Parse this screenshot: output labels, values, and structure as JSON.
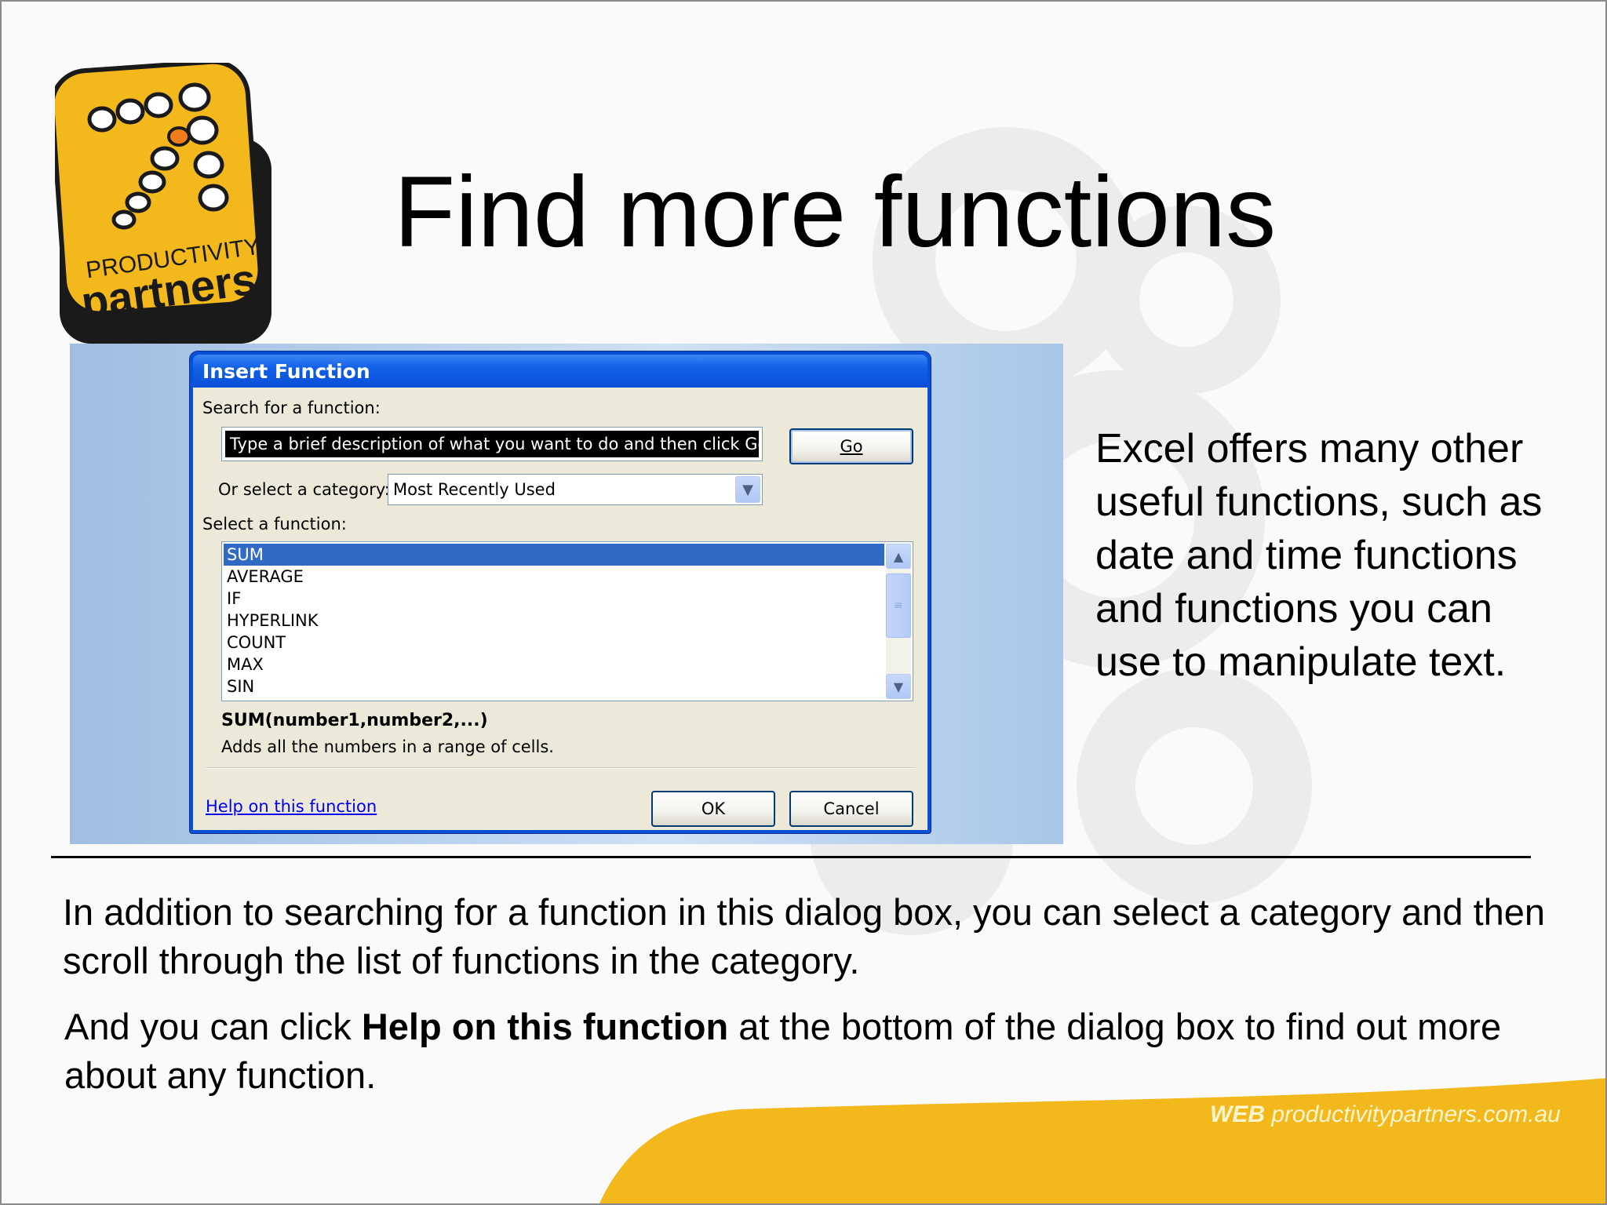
{
  "slide": {
    "title": "Find more functions",
    "side_text": "Excel offers many other useful functions, such as date and time functions and functions you can use to manipulate text.",
    "paragraph1": "In addition to searching for a function in this dialog box,  you can select a category and then scroll through the list of functions in the category.",
    "paragraph2_prefix": "And you can click ",
    "paragraph2_bold": "Help on this function",
    "paragraph2_suffix": " at the bottom of the dialog box to find out more about any function.",
    "footer_url": "productivitypartners.com.au",
    "footer_prefix": "WEB",
    "logo_line1": "PRODUCTIVITY",
    "logo_line2": "partners"
  },
  "dialog": {
    "title": "Insert Function",
    "search_label": "Search for a function:",
    "search_value": "Type a brief description of what you  want to do and then click Go",
    "go_button": "Go",
    "category_label": "Or select a category:",
    "category_value": "Most Recently Used",
    "function_label": "Select a function:",
    "functions": [
      "SUM",
      "AVERAGE",
      "IF",
      "HYPERLINK",
      "COUNT",
      "MAX",
      "SIN"
    ],
    "selected_function": "SUM",
    "signature": "SUM(number1,number2,...)",
    "description": "Adds all the numbers in a range of cells.",
    "help_link": "Help on this function",
    "ok_button": "OK",
    "cancel_button": "Cancel"
  },
  "colors": {
    "accent_yellow": "#f2b81c",
    "xp_blue": "#0a4fd8",
    "selection_blue": "#316ac5"
  }
}
